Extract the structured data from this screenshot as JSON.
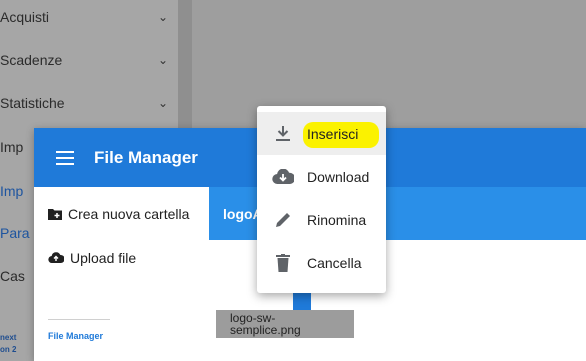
{
  "background_sidebar": {
    "items": [
      {
        "label": "Acquisti"
      },
      {
        "label": "Scadenze"
      },
      {
        "label": "Statistiche"
      }
    ],
    "cut_items": [
      "Imp",
      "Imp",
      "Para",
      "Cas"
    ],
    "footer_lines": [
      "next",
      "on 2"
    ]
  },
  "dialog": {
    "title": "File Manager",
    "left_panel": {
      "new_folder": "Crea nuova cartella",
      "upload": "Upload file",
      "footer_link": "File Manager"
    },
    "right_panel": {
      "header": "logoA",
      "file": {
        "name": "logo-sw-semplice.png"
      }
    }
  },
  "context_menu": {
    "items": [
      {
        "label": "Inserisci",
        "icon": "download-arrow-icon",
        "active": true,
        "highlighted": true
      },
      {
        "label": "Download",
        "icon": "cloud-download-icon"
      },
      {
        "label": "Rinomina",
        "icon": "pencil-icon"
      },
      {
        "label": "Cancella",
        "icon": "trash-icon"
      }
    ]
  },
  "colors": {
    "primary": "#1f7ad9",
    "panel_header": "#2a8fe8",
    "highlight": "#fbf200",
    "overlay_bg": "#9e9e9e"
  }
}
